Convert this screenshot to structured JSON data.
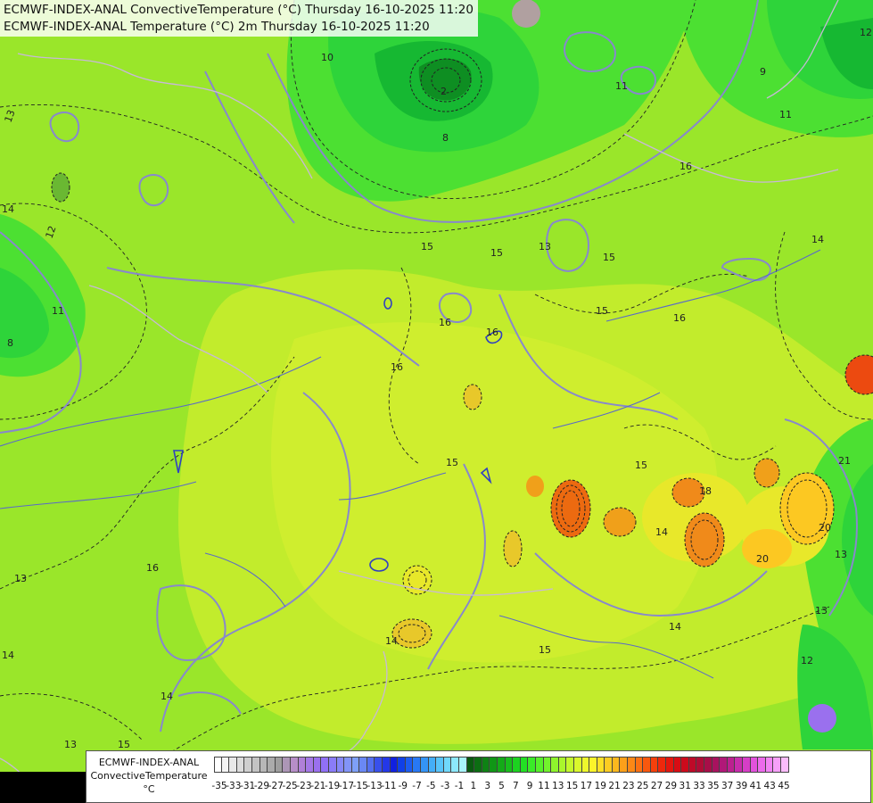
{
  "header": {
    "line1": "ECMWF-INDEX-ANAL ConvectiveTemperature (°C) Thursday 16-10-2025 11:20",
    "line2": "ECMWF-INDEX-ANAL Temperature (°C) 2m Thursday 16-10-2025 11:20"
  },
  "legend": {
    "title_line1": "ECMWF-INDEX-ANAL",
    "title_line2": "ConvectiveTemperature",
    "title_line3": "°C",
    "ticks": [
      "-35",
      "-33",
      "-31",
      "-29",
      "-27",
      "-25",
      "-23",
      "-21",
      "-19",
      "-17",
      "-15",
      "-13",
      "-11",
      "-9",
      "-7",
      "-5",
      "-3",
      "-1",
      "1",
      "3",
      "5",
      "7",
      "9",
      "11",
      "13",
      "15",
      "17",
      "19",
      "21",
      "23",
      "25",
      "27",
      "29",
      "31",
      "33",
      "35",
      "37",
      "39",
      "41",
      "43",
      "45"
    ],
    "colors": [
      "#ffffff",
      "#f4f4f4",
      "#e8e8e8",
      "#dcdcdc",
      "#cfcfcf",
      "#c3c3c3",
      "#b7b7b7",
      "#ababab",
      "#9e9e9e",
      "#ac96b6",
      "#b68ec8",
      "#b080d8",
      "#a478e6",
      "#9a70ee",
      "#9070f6",
      "#8a7cf8",
      "#8688f8",
      "#8294f8",
      "#7ea0f8",
      "#6a88f4",
      "#5470f0",
      "#3850ec",
      "#2438e8",
      "#1020e0",
      "#1040e8",
      "#1c5cf0",
      "#2878f4",
      "#3494f6",
      "#44aef8",
      "#58c4fa",
      "#70d8fc",
      "#8ce8fc",
      "#a8f4fc",
      "#0a5a10",
      "#0c6e12",
      "#0e8214",
      "#109616",
      "#14aa18",
      "#18be1c",
      "#1cd220",
      "#22e024",
      "#3aea28",
      "#56f02a",
      "#72f22c",
      "#8ef42c",
      "#aaf62c",
      "#c4f82c",
      "#daf82c",
      "#eef82c",
      "#fcf42a",
      "#fce026",
      "#fccc22",
      "#fcb81e",
      "#fca01a",
      "#fc8816",
      "#fc7012",
      "#f8580e",
      "#f4400c",
      "#ee280c",
      "#e4160e",
      "#d80c14",
      "#cc0a1c",
      "#be0a28",
      "#b00c36",
      "#a80e48",
      "#a8125e",
      "#b01878",
      "#bc2090",
      "#c82cac",
      "#d63ec6",
      "#e252dc",
      "#ec6aec",
      "#f284f4",
      "#f6a0f8",
      "#fabcfa"
    ],
    "unit": "°C"
  },
  "map": {
    "contour_labels": [
      "13",
      "14",
      "12",
      "8",
      "11",
      "10",
      "8",
      "2",
      "9",
      "11",
      "11",
      "14",
      "15",
      "13",
      "15",
      "15",
      "16",
      "16",
      "16",
      "15",
      "14",
      "15",
      "13",
      "14",
      "14",
      "15",
      "16",
      "13",
      "14",
      "13",
      "13",
      "16",
      "16",
      "15",
      "12",
      "15",
      "14",
      "18",
      "20",
      "21",
      "20",
      "12"
    ],
    "colors": {
      "base": "#9ae62a",
      "light_green": "#b4ec2c",
      "yellow_green": "#c8ee2c",
      "green": "#4ce032",
      "mid_green": "#2ed43a",
      "dark_green": "#16b832",
      "darkest_green": "#0e8e22",
      "yellow": "#e8e82a",
      "orange": "#f08a1a",
      "dark_orange": "#ec6a10",
      "isoline": "#8888cc",
      "dashed_isoline": "#222222",
      "border": "#c8b8d8"
    }
  }
}
